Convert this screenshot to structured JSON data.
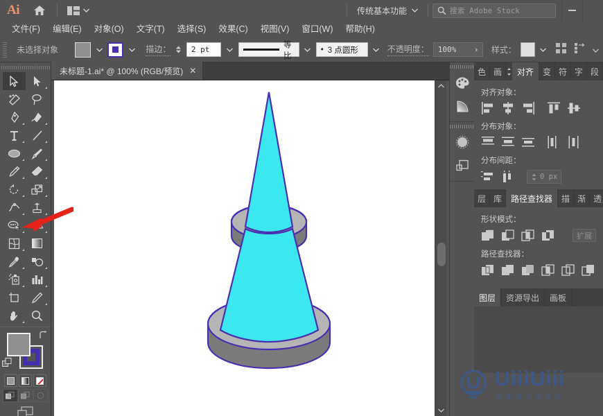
{
  "app": {
    "name": "Ai",
    "logo_text": "Ai",
    "home_icon": "home-icon",
    "arrange_icon": "arrange-documents-icon"
  },
  "titlebar": {
    "workspace": "传统基本功能",
    "workspace_chevron": "chevron-down-icon",
    "search_icon": "search-icon",
    "search_placeholder": "搜索 Adobe Stock",
    "minimize": "minimize-icon"
  },
  "menubar": {
    "items": [
      {
        "label": "文件(F)",
        "accel": "F"
      },
      {
        "label": "编辑(E)",
        "accel": "E"
      },
      {
        "label": "对象(O)",
        "accel": "O"
      },
      {
        "label": "文字(T)",
        "accel": "T"
      },
      {
        "label": "选择(S)",
        "accel": "S"
      },
      {
        "label": "效果(C)",
        "accel": "C"
      },
      {
        "label": "视图(V)",
        "accel": "V"
      },
      {
        "label": "窗口(W)",
        "accel": "W"
      },
      {
        "label": "帮助(H)",
        "accel": "H"
      }
    ]
  },
  "controlbar": {
    "selection_status": "未选择对象",
    "fill_color": "#8f8f8f",
    "stroke_color": "#4b2fb0",
    "stroke_label": "描边：",
    "stroke_weight": "2 pt",
    "profile_label": "等比",
    "brush_label": "3 点圆形",
    "brush_bullet": "•",
    "opacity_label": "不透明度：",
    "opacity_value": "100%",
    "style_label": "样式：",
    "align_icon": "align-panel-icon",
    "arrange_icon": "arrange-icon"
  },
  "toolbar": {
    "tools": [
      {
        "name": "selection-tool",
        "label": "选择工具",
        "active": true
      },
      {
        "name": "direct-selection-tool",
        "label": "直接选择工具",
        "active": false
      },
      {
        "name": "magic-wand-tool",
        "label": "魔棒工具",
        "active": false
      },
      {
        "name": "lasso-tool",
        "label": "套索工具",
        "active": false
      },
      {
        "name": "pen-tool",
        "label": "钢笔工具",
        "active": false
      },
      {
        "name": "curvature-tool",
        "label": "曲率工具",
        "active": false
      },
      {
        "name": "type-tool",
        "label": "文字工具",
        "active": false
      },
      {
        "name": "line-segment-tool",
        "label": "直线段工具",
        "active": false
      },
      {
        "name": "ellipse-tool",
        "label": "椭圆工具",
        "active": false
      },
      {
        "name": "paintbrush-tool",
        "label": "画笔工具",
        "active": false
      },
      {
        "name": "pencil-tool",
        "label": "铅笔工具",
        "active": false
      },
      {
        "name": "eraser-tool",
        "label": "橡皮擦工具",
        "active": false
      },
      {
        "name": "rotate-tool",
        "label": "旋转工具",
        "active": false
      },
      {
        "name": "scale-tool",
        "label": "比例缩放工具",
        "active": false
      },
      {
        "name": "width-tool",
        "label": "宽度工具",
        "active": false
      },
      {
        "name": "free-transform-tool",
        "label": "自由变换工具",
        "active": false
      },
      {
        "name": "shape-builder-tool",
        "label": "形状生成器工具",
        "active": false
      },
      {
        "name": "perspective-grid-tool",
        "label": "透视网格工具",
        "active": false
      },
      {
        "name": "mesh-tool",
        "label": "网格工具",
        "active": false
      },
      {
        "name": "gradient-tool",
        "label": "渐变工具",
        "active": false
      },
      {
        "name": "eyedropper-tool",
        "label": "吸管工具",
        "active": false
      },
      {
        "name": "blend-tool",
        "label": "混合工具",
        "active": false
      },
      {
        "name": "symbol-sprayer-tool",
        "label": "符号喷枪工具",
        "active": false
      },
      {
        "name": "column-graph-tool",
        "label": "柱形图工具",
        "active": false
      },
      {
        "name": "artboard-tool",
        "label": "画板工具",
        "active": false
      },
      {
        "name": "slice-tool",
        "label": "切片工具",
        "active": false
      },
      {
        "name": "hand-tool",
        "label": "抓手工具",
        "active": false
      },
      {
        "name": "zoom-tool",
        "label": "缩放工具",
        "active": false
      }
    ],
    "fill_color": "#8f8f8f",
    "stroke_color": "#4230ad",
    "swap_icon": "swap-fill-stroke-icon",
    "default_icon": "default-fill-stroke-icon",
    "modes": [
      {
        "name": "color-mode-button",
        "label": "颜色"
      },
      {
        "name": "gradient-mode-button",
        "label": "渐变"
      },
      {
        "name": "none-mode-button",
        "label": "无"
      }
    ],
    "draw_modes": [
      {
        "name": "draw-normal-button",
        "label": "正常绘图",
        "selected": true
      },
      {
        "name": "draw-behind-button",
        "label": "背面绘图",
        "selected": false
      },
      {
        "name": "draw-inside-button",
        "label": "内部绘图",
        "selected": false
      }
    ],
    "screen_mode": "change-screen-mode-button"
  },
  "document": {
    "tab_title": "未标题-1.ai* @ 100% (RGB/预览)",
    "close_icon": "close-icon",
    "zoom": "100%",
    "color_mode": "RGB",
    "view_mode": "预览"
  },
  "artwork": {
    "description": "3D 圆锥体",
    "cone_fill": "#3ce8f0",
    "ring_light": "#b5b5b5",
    "ring_dark": "#7b7b7b",
    "outline": "#4b2fb0"
  },
  "annotation": {
    "arrow_color": "#e8231a",
    "points_to": "shape-builder-tool"
  },
  "scrollbar": {
    "up_icon": "chevron-up-icon",
    "down_icon": "chevron-down-icon"
  },
  "icondock": {
    "items": [
      {
        "name": "color-panel-icon",
        "label": "颜色"
      },
      {
        "name": "gradient-panel-icon",
        "label": "渐变"
      },
      {
        "name": "brushes-panel-icon",
        "label": "画笔"
      },
      {
        "name": "layers-panel-icon",
        "label": "图层"
      }
    ]
  },
  "panels": {
    "align": {
      "tabs": [
        {
          "label": "色",
          "active": false,
          "name": "tab-color"
        },
        {
          "label": "画",
          "active": false,
          "name": "tab-brushes"
        },
        {
          "label": "对齐",
          "active": true,
          "name": "tab-align"
        },
        {
          "label": "变",
          "active": false,
          "name": "tab-transform"
        },
        {
          "label": "符",
          "active": false,
          "name": "tab-symbols"
        },
        {
          "label": "字",
          "active": false,
          "name": "tab-character"
        },
        {
          "label": "段",
          "active": false,
          "name": "tab-paragraph"
        }
      ],
      "align_objects_label": "对齐对象：",
      "align_buttons": [
        {
          "name": "align-left-button",
          "label": "水平左对齐"
        },
        {
          "name": "align-center-h-button",
          "label": "水平居中对齐"
        },
        {
          "name": "align-right-button",
          "label": "水平右对齐"
        },
        {
          "name": "align-top-button",
          "label": "垂直顶对齐"
        },
        {
          "name": "align-center-v-button",
          "label": "垂直居中对齐"
        }
      ],
      "distribute_objects_label": "分布对象：",
      "distribute_buttons": [
        {
          "name": "distribute-top-button",
          "label": "垂直顶分布"
        },
        {
          "name": "distribute-center-v-button",
          "label": "垂直居中分布"
        },
        {
          "name": "distribute-bottom-button",
          "label": "垂直底分布"
        },
        {
          "name": "distribute-left-button",
          "label": "水平左分布"
        },
        {
          "name": "distribute-center-h-button",
          "label": "水平居中分布"
        }
      ],
      "distribute_spacing_label": "分布间距：",
      "spacing_buttons": [
        {
          "name": "vertical-distribute-space-button",
          "label": "垂直分布间距"
        },
        {
          "name": "horizontal-distribute-space-button",
          "label": "水平分布间距"
        }
      ],
      "spacing_value": "0 px",
      "spacing_stepper": "stepper-icon"
    },
    "pathfinder": {
      "tabs": [
        {
          "label": "层",
          "active": false,
          "name": "tab-layers"
        },
        {
          "label": "库",
          "active": false,
          "name": "tab-libraries"
        },
        {
          "label": "路径查找器",
          "active": true,
          "name": "tab-pathfinder"
        },
        {
          "label": "描",
          "active": false,
          "name": "tab-stroke"
        },
        {
          "label": "渐",
          "active": false,
          "name": "tab-gradient"
        },
        {
          "label": "透",
          "active": false,
          "name": "tab-transparency"
        }
      ],
      "shape_modes_label": "形状模式：",
      "shape_mode_buttons": [
        {
          "name": "unite-button",
          "label": "联集"
        },
        {
          "name": "minus-front-button",
          "label": "减去顶层"
        },
        {
          "name": "intersect-button",
          "label": "交集"
        },
        {
          "name": "exclude-button",
          "label": "差集"
        }
      ],
      "expand_label": "扩展",
      "pathfinders_label": "路径查找器：",
      "pathfinder_buttons": [
        {
          "name": "divide-button",
          "label": "分割"
        },
        {
          "name": "trim-button",
          "label": "修边"
        },
        {
          "name": "merge-button",
          "label": "合并"
        },
        {
          "name": "crop-button",
          "label": "裁剪"
        },
        {
          "name": "outline-button",
          "label": "轮廓"
        },
        {
          "name": "minus-back-button",
          "label": "减去后方对象"
        }
      ]
    },
    "layers": {
      "tabs": [
        {
          "label": "图层",
          "active": true,
          "name": "tab-layers"
        },
        {
          "label": "资源导出",
          "active": false,
          "name": "tab-asset-export"
        },
        {
          "label": "画板",
          "active": false,
          "name": "tab-artboards"
        }
      ]
    }
  },
  "watermark": {
    "text": "UiiiUiii",
    "subtitle": "自学就上优设网",
    "color": "#3b5b93"
  }
}
